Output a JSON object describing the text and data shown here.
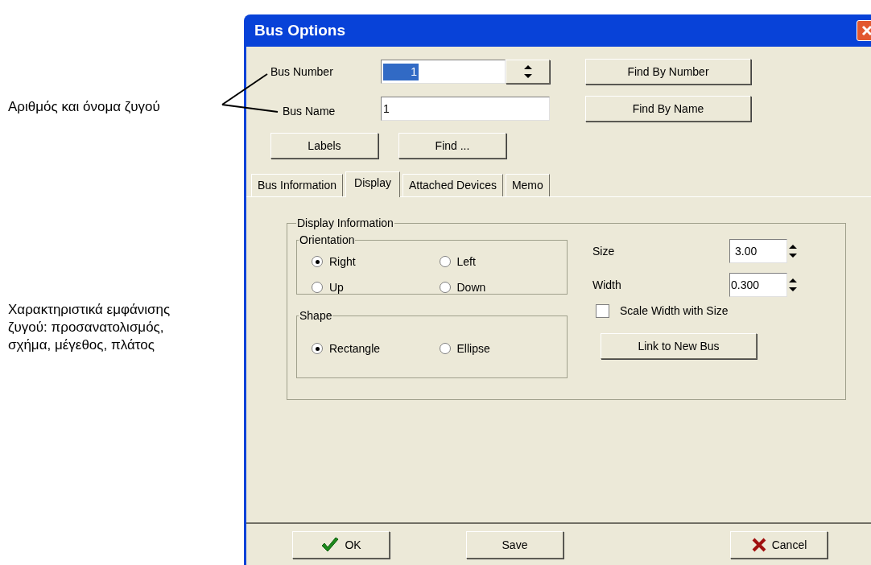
{
  "annotations": [
    {
      "text": "Αριθμός και όνομα ζυγού"
    },
    {
      "text": "Χαρακτηριστικά εμφάνισης ζυγού: προσανατολισμός, σχήμα, μέγεθος, πλάτος"
    }
  ],
  "window": {
    "title": "Bus Options"
  },
  "bus_number": {
    "label": "Bus Number",
    "value": "1",
    "highlighted": true
  },
  "bus_name": {
    "label": "Bus Name",
    "value": "1"
  },
  "find_buttons": [
    "Find By Number",
    "Find By Name"
  ],
  "buttons": [
    "Labels",
    "Find ..."
  ],
  "tabs": [
    {
      "label": "Bus Information",
      "selected": false
    },
    {
      "label": "Display",
      "selected": true
    },
    {
      "label": "Attached Devices",
      "selected": false
    },
    {
      "label": "Memo",
      "selected": false
    }
  ],
  "display_information": {
    "title": "Display Information",
    "orientation": {
      "title": "Orientation",
      "options": [
        {
          "label": "Right",
          "selected": true
        },
        {
          "label": "Left",
          "selected": false
        },
        {
          "label": "Up",
          "selected": false
        },
        {
          "label": "Down",
          "selected": false
        }
      ]
    },
    "shape": {
      "title": "Shape",
      "options": [
        {
          "label": "Rectangle",
          "selected": true
        },
        {
          "label": "Ellipse",
          "selected": false
        }
      ]
    },
    "size": {
      "label": "Size",
      "value": "3.00"
    },
    "width": {
      "label": "Width",
      "value": "0.300"
    },
    "scale_width": {
      "label": "Scale Width with Size",
      "checked": false
    },
    "link_button": "Link to New Bus"
  },
  "footer_buttons": [
    {
      "label": "OK",
      "kind": "ok"
    },
    {
      "label": "Save",
      "kind": "plain"
    },
    {
      "label": "Cancel",
      "kind": "cancel"
    }
  ]
}
